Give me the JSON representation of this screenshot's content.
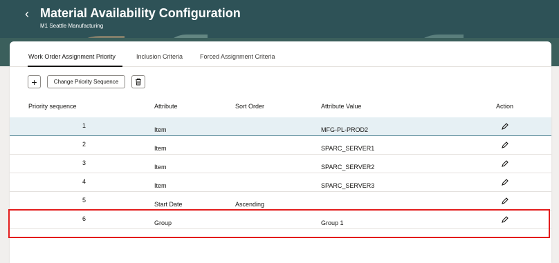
{
  "header": {
    "title": "Material Availability Configuration",
    "subtitle": "M1 Seattle Manufacturing",
    "back_glyph": "‹"
  },
  "tabs": [
    {
      "label": "Work Order Assignment Priority",
      "active": true
    },
    {
      "label": "Inclusion Criteria",
      "active": false
    },
    {
      "label": "Forced Assignment Criteria",
      "active": false
    }
  ],
  "toolbar": {
    "add_glyph": "+",
    "change_priority_label": "Change Priority Sequence",
    "delete_icon": "trash-icon"
  },
  "table": {
    "columns": {
      "priority": "Priority sequence",
      "attribute": "Attribute",
      "sort_order": "Sort Order",
      "attribute_value": "Attribute Value",
      "action": "Action"
    },
    "rows": [
      {
        "priority": "1",
        "attribute": "Item",
        "sort_order": "",
        "attribute_value": "MFG-PL-PROD2",
        "selected": true
      },
      {
        "priority": "2",
        "attribute": "Item",
        "sort_order": "",
        "attribute_value": "SPARC_SERVER1",
        "selected": false
      },
      {
        "priority": "3",
        "attribute": "Item",
        "sort_order": "",
        "attribute_value": "SPARC_SERVER2",
        "selected": false
      },
      {
        "priority": "4",
        "attribute": "Item",
        "sort_order": "",
        "attribute_value": "SPARC_SERVER3",
        "selected": false
      },
      {
        "priority": "5",
        "attribute": "Start Date",
        "sort_order": "Ascending",
        "attribute_value": "",
        "selected": false
      },
      {
        "priority": "6",
        "attribute": "Group",
        "sort_order": "",
        "attribute_value": "Group 1",
        "selected": false
      }
    ],
    "action_icon": "pencil-edit-icon"
  },
  "colors": {
    "header_bg": "#2e5257",
    "selected_row": "#e6f0f4",
    "highlight": "#e31c1c"
  }
}
